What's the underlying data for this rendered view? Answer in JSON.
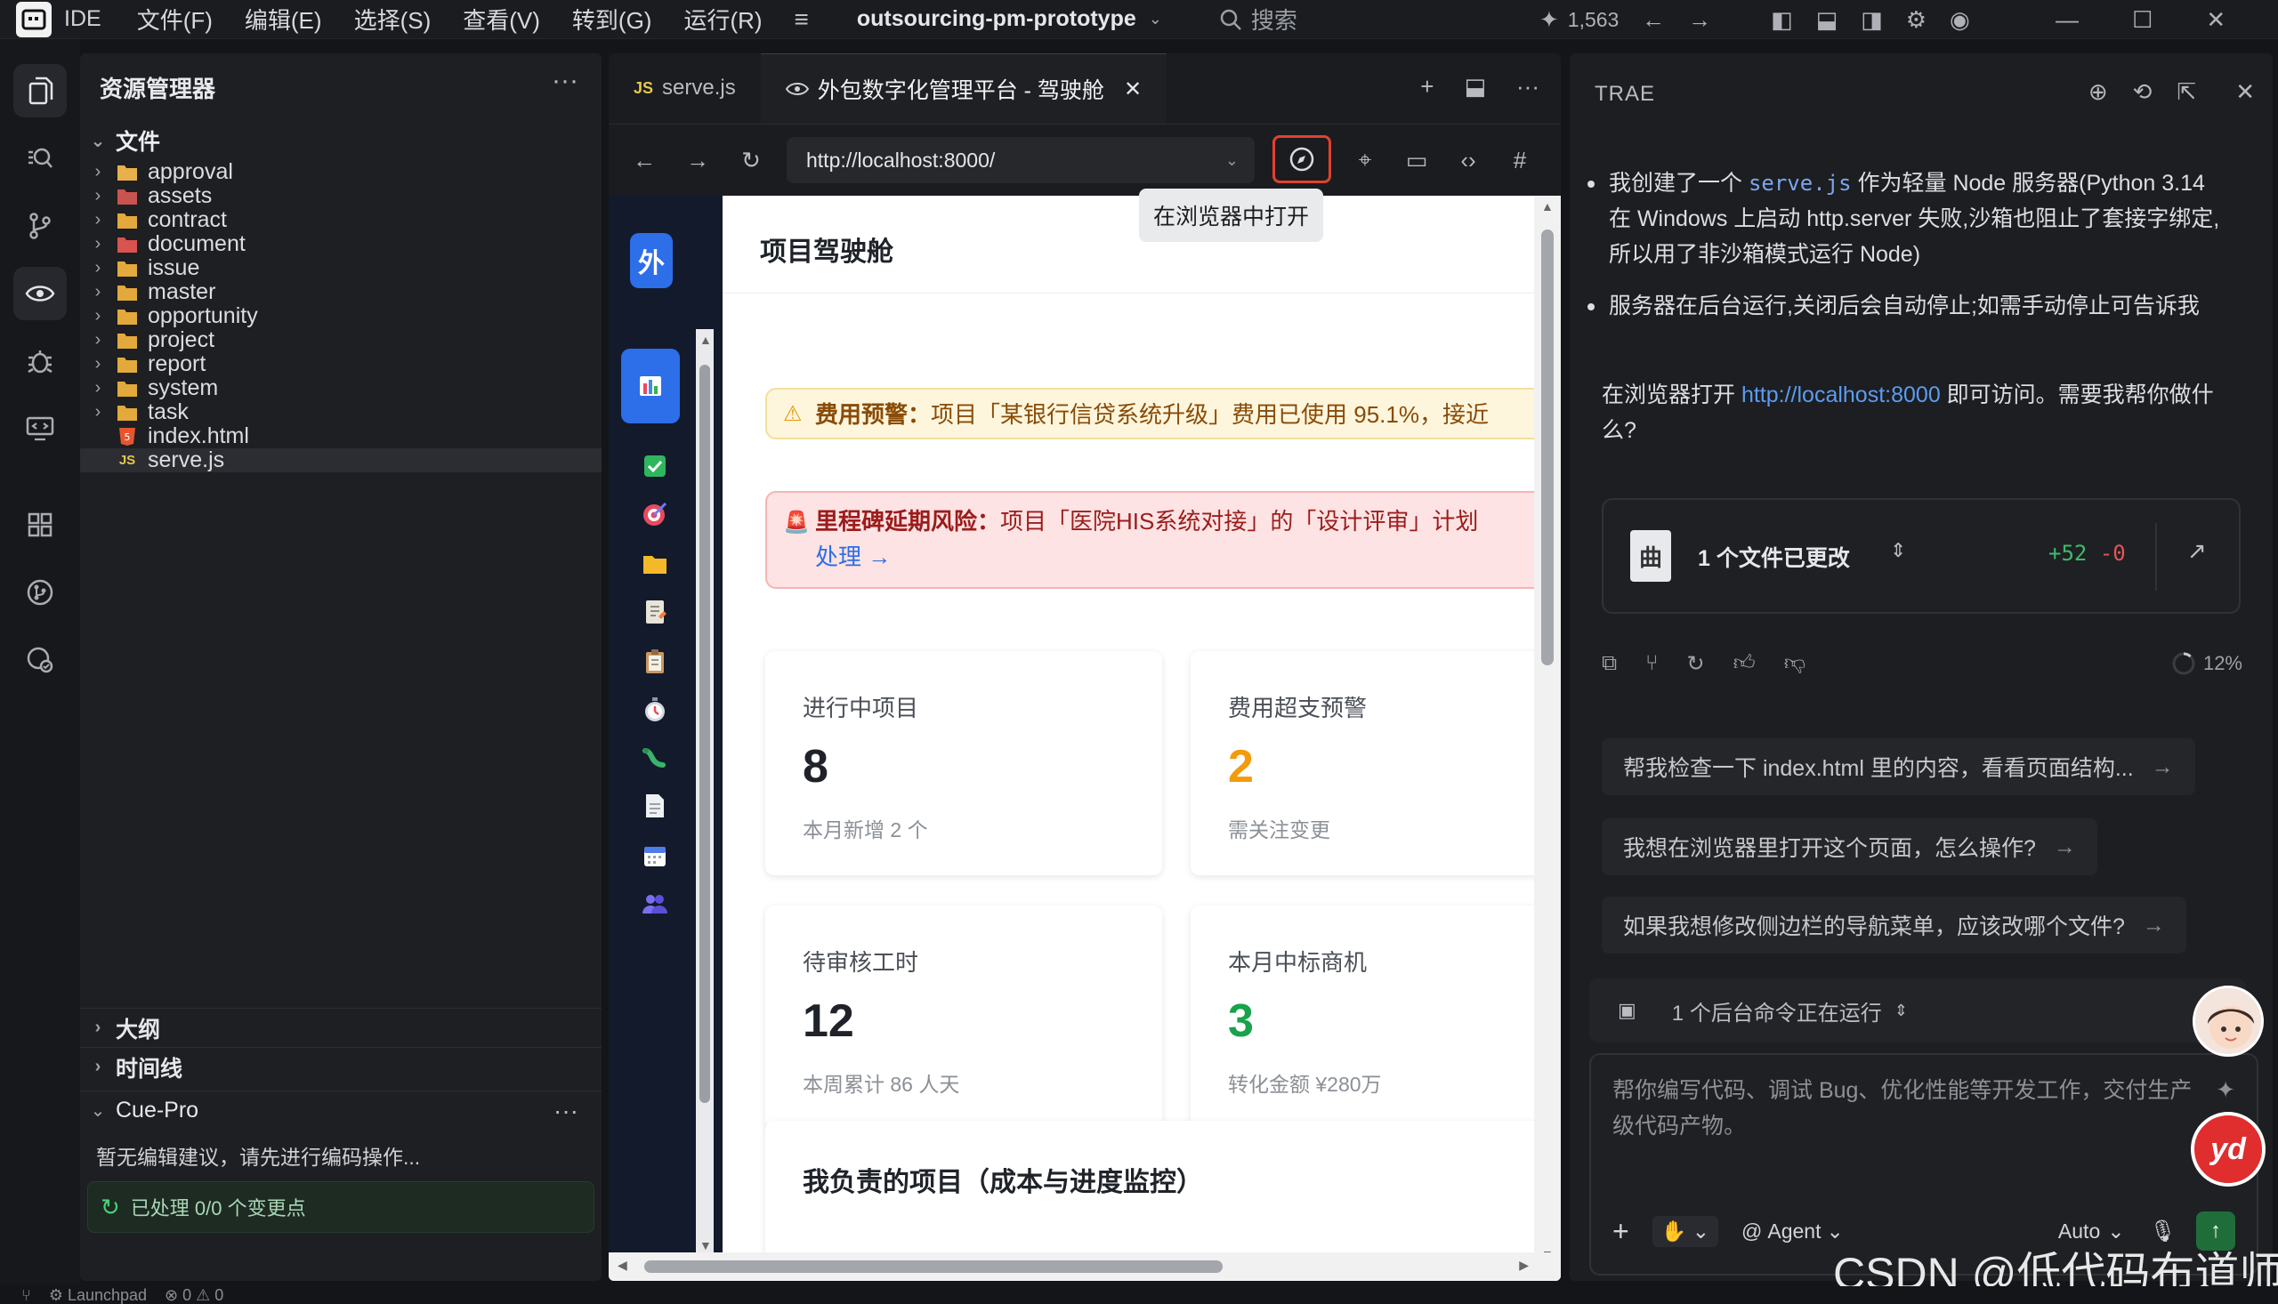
{
  "titlebar": {
    "ide_label": "IDE",
    "menus": [
      "文件(F)",
      "编辑(E)",
      "选择(S)",
      "查看(V)",
      "转到(G)",
      "运行(R)"
    ],
    "project": "outsourcing-pm-prototype",
    "search_placeholder": "搜索",
    "credits": "1,563"
  },
  "explorer": {
    "title": "资源管理器",
    "root": "文件",
    "items": [
      {
        "label": "approval",
        "type": "folder"
      },
      {
        "label": "assets",
        "type": "folder"
      },
      {
        "label": "contract",
        "type": "folder"
      },
      {
        "label": "document",
        "type": "folder"
      },
      {
        "label": "issue",
        "type": "folder"
      },
      {
        "label": "master",
        "type": "folder"
      },
      {
        "label": "opportunity",
        "type": "folder"
      },
      {
        "label": "project",
        "type": "folder"
      },
      {
        "label": "report",
        "type": "folder"
      },
      {
        "label": "system",
        "type": "folder"
      },
      {
        "label": "task",
        "type": "folder"
      },
      {
        "label": "index.html",
        "type": "html"
      },
      {
        "label": "serve.js",
        "type": "js"
      }
    ],
    "sections": {
      "outline": "大纲",
      "timeline": "时间线",
      "cue": "Cue-Pro"
    },
    "cue_empty": "暂无编辑建议，请先进行编码操作...",
    "cue_status": "已处理 0/0 个变更点"
  },
  "editor": {
    "tabs": [
      {
        "badge": "JS",
        "label": "serve.js"
      },
      {
        "label": "外包数字化管理平台 - 驾驶舱"
      }
    ],
    "url": "http://localhost:8000/",
    "tooltip": "在浏览器中打开"
  },
  "webpage": {
    "brand": "外",
    "title": "项目驾驶舱",
    "alert_cost": {
      "label": "费用预警：",
      "text": "项目「某银行信贷系统升级」费用已使用 95.1%，接近"
    },
    "alert_milestone": {
      "label": "里程碑延期风险：",
      "text": "项目「医院HIS系统对接」的「设计评审」计划",
      "link": "处理 →"
    },
    "cards": [
      {
        "label": "进行中项目",
        "value": "8",
        "sub": "本月新增 2 个",
        "color": "#1f2329"
      },
      {
        "label": "费用超支预警",
        "value": "2",
        "sub": "需关注变更",
        "color": "#f29b0c"
      },
      {
        "label": "待审核工时",
        "value": "12",
        "sub": "本周累计 86 人天",
        "color": "#1f2329"
      },
      {
        "label": "本月中标商机",
        "value": "3",
        "sub": "转化金额 ¥280万",
        "color": "#17a34a"
      }
    ],
    "projects_title": "我负责的项目（成本与进度监控）"
  },
  "assistant": {
    "title": "TRAE",
    "bullet1_pre": "我创建了一个 ",
    "bullet1_code": "serve.js",
    "bullet1_post": " 作为轻量 Node 服务器(Python 3.14 在 Windows 上启动 http.server 失败,沙箱也阻止了套接字绑定,所以用了非沙箱模式运行 Node)",
    "bullet2": "服务器在后台运行,关闭后会自动停止;如需手动停止可告诉我",
    "para_pre": "在浏览器打开 ",
    "para_link": "http://localhost:8000",
    "para_post": " 即可访问。需要我帮你做什么?",
    "file_changes": "1 个文件已更改",
    "added": "+52",
    "removed": "-0",
    "progress": "12%",
    "suggestions": [
      "帮我检查一下 index.html 里的内容，看看页面结构...",
      "我想在浏览器里打开这个页面，怎么操作?",
      "如果我想修改侧边栏的导航菜单，应该改哪个文件?"
    ],
    "bg_command": "1 个后台命令正在运行",
    "input_placeholder": "帮你编写代码、调试 Bug、优化性能等开发工作，交付生产级代码产物。",
    "agent_label": "Agent",
    "mode_label": "Auto"
  },
  "watermark": "CSDN @低代码布道师",
  "statusbar": {
    "launchpad": "Launchpad",
    "errors": "0",
    "warnings": "0"
  }
}
